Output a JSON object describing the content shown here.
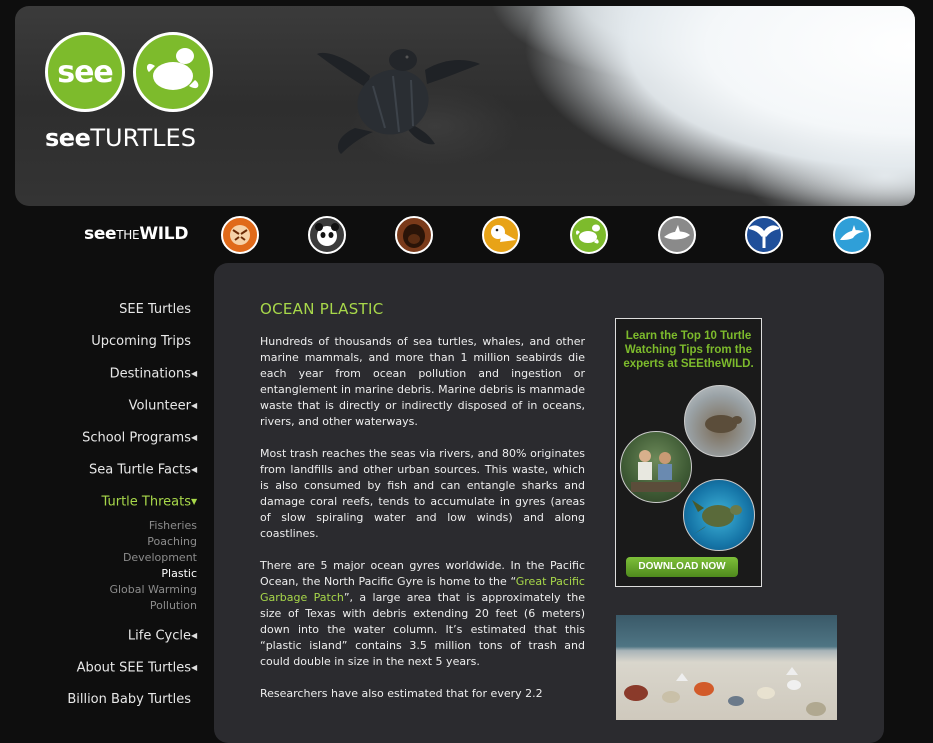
{
  "header": {
    "logo_badge": "see",
    "logo_word_bold": "see",
    "logo_word_rest": "TURTLES"
  },
  "wild": {
    "bold": "see",
    "small": "THE",
    "rest": "WILD",
    "species": [
      {
        "icon": "tiger-icon",
        "color": "#e06a1a"
      },
      {
        "icon": "panda-icon",
        "color": "#3b3b3b"
      },
      {
        "icon": "gorilla-icon",
        "color": "#7a3a1a"
      },
      {
        "icon": "pelican-icon",
        "color": "#e8a317"
      },
      {
        "icon": "sea-turtle-icon",
        "color": "#7dbb2c"
      },
      {
        "icon": "shark-icon",
        "color": "#8a8a8a"
      },
      {
        "icon": "whale-tail-icon",
        "color": "#1f4f9a"
      },
      {
        "icon": "dolphin-icon",
        "color": "#2f9fd8"
      }
    ]
  },
  "nav": {
    "items": [
      {
        "label": "SEE Turtles",
        "arrow": ""
      },
      {
        "label": "Upcoming Trips",
        "arrow": ""
      },
      {
        "label": "Destinations",
        "arrow": "◀"
      },
      {
        "label": "Volunteer",
        "arrow": "◀"
      },
      {
        "label": "School Programs",
        "arrow": "◀"
      },
      {
        "label": "Sea Turtle Facts",
        "arrow": "◀"
      },
      {
        "label": "Turtle Threats",
        "arrow": "▼"
      },
      {
        "label": "Life Cycle",
        "arrow": "◀"
      },
      {
        "label": "About SEE Turtles",
        "arrow": "◀"
      },
      {
        "label": "Billion Baby Turtles",
        "arrow": ""
      }
    ],
    "threats_sub": [
      "Fisheries",
      "Poaching",
      "Development",
      "Plastic",
      "Global Warming",
      "Pollution"
    ]
  },
  "article": {
    "title": "OCEAN PLASTIC",
    "p1": "Hundreds of thousands of sea turtles, whales, and other marine mammals, and more than 1 million seabirds die each year from ocean pollution and ingestion or entanglement in marine debris. Marine debris is manmade waste that is directly or indirectly disposed of in oceans, rivers, and other waterways.",
    "p2": "Most trash reaches the seas via rivers, and 80% originates from landfills and other urban sources. This waste, which is also consumed by fish and can entangle sharks and damage coral reefs, tends to accumulate in gyres (areas of slow spiraling water and low winds) and along coastlines.",
    "p3_a": "There are 5 major ocean gyres worldwide. In the Pacific Ocean, the North Pacific Gyre is home to the “",
    "p3_link": "Great Pacific Garbage Patch",
    "p3_b": "”, a large area that is approximately the size of Texas with debris extending 20 feet (6 meters) down into the water column. It’s estimated that this “plastic island” contains 3.5 million tons of trash and could double in size in the next 5 years.",
    "p4": "Researchers have also estimated that for every 2.2"
  },
  "ad": {
    "title": "Learn the Top 10 Turtle Watching Tips from the experts at SEEtheWILD.",
    "button": "DOWNLOAD NOW"
  }
}
